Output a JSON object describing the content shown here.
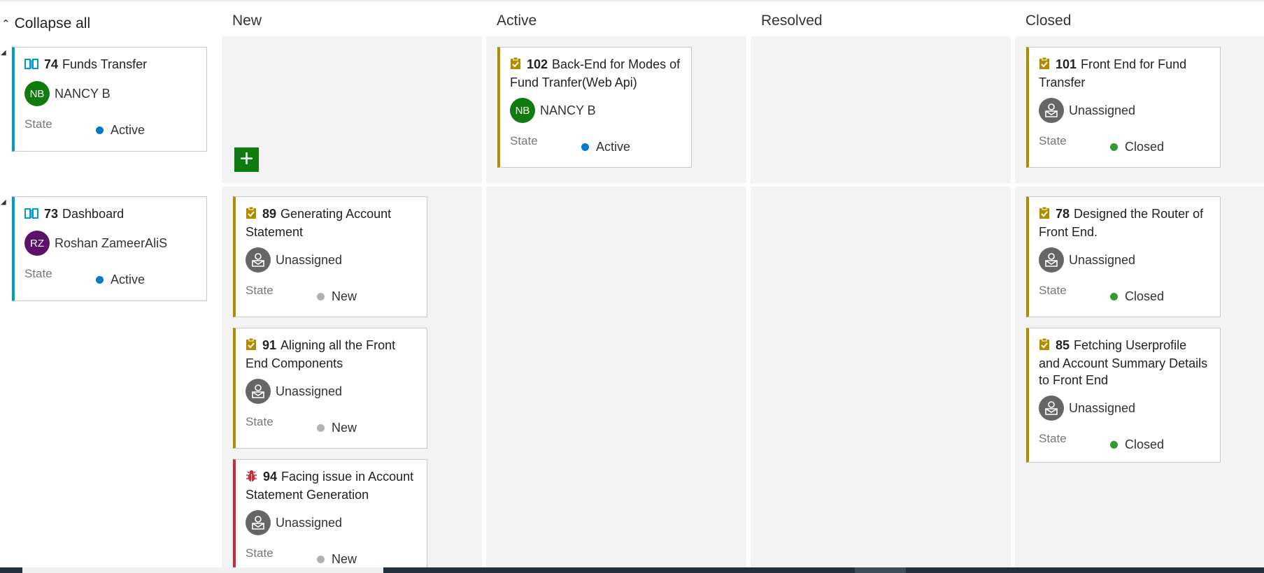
{
  "toolbar": {
    "collapse_label": "Collapse all"
  },
  "columns": {
    "new": "New",
    "active": "Active",
    "resolved": "Resolved",
    "closed": "Closed"
  },
  "common": {
    "state_label": "State"
  },
  "colors": {
    "story_border": "#009ccc",
    "task_border": "#b18c00",
    "bug_border": "#cc293d",
    "state_new": "#b2b2b2",
    "state_active": "#007acc",
    "state_closed": "#339933",
    "add_button": "#107c10"
  },
  "rows": [
    {
      "parent": {
        "id": "74",
        "title": "Funds Transfer",
        "type": "book-icon",
        "assignee_initials": "NB",
        "assignee": "NANCY B",
        "state": "Active"
      },
      "cards": {
        "active": [
          {
            "id": "102",
            "title": "Back-End for Modes of Fund Tranfer(Web Api)",
            "type": "task-icon",
            "assignee_initials": "NB",
            "assignee": "NANCY B",
            "state": "Active"
          }
        ],
        "closed": [
          {
            "id": "101",
            "title": "Front End for Fund Transfer",
            "type": "task-icon",
            "assignee": "Unassigned",
            "state": "Closed"
          }
        ]
      }
    },
    {
      "parent": {
        "id": "73",
        "title": "Dashboard",
        "type": "book-icon",
        "assignee_initials": "RZ",
        "assignee": "Roshan ZameerAliS",
        "state": "Active"
      },
      "cards": {
        "new": [
          {
            "id": "89",
            "title": "Generating Account Statement",
            "type": "task-icon",
            "assignee": "Unassigned",
            "state": "New"
          },
          {
            "id": "91",
            "title": "Aligning all the Front End Components",
            "type": "task-icon",
            "assignee": "Unassigned",
            "state": "New"
          },
          {
            "id": "94",
            "title": "Facing issue in Account Statement Generation",
            "type": "bug-icon",
            "assignee": "Unassigned",
            "state": "New"
          }
        ],
        "closed": [
          {
            "id": "78",
            "title": "Designed the Router of Front End.",
            "type": "task-icon",
            "assignee": "Unassigned",
            "state": "Closed"
          },
          {
            "id": "85",
            "title": "Fetching Userprofile and Account Summary Details to Front End",
            "type": "task-icon",
            "assignee": "Unassigned",
            "state": "Closed"
          }
        ]
      }
    }
  ],
  "add_button": {
    "symbol": "+"
  }
}
